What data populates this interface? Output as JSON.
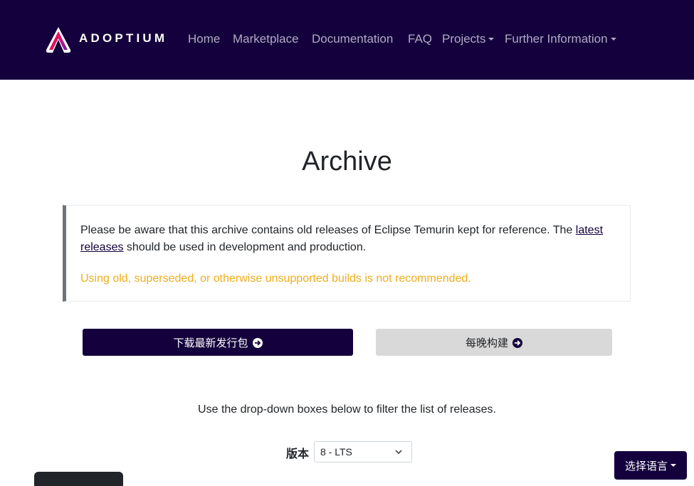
{
  "header": {
    "brand": "ADOPTIUM",
    "nav": [
      {
        "label": "Home"
      },
      {
        "label": "Marketplace"
      },
      {
        "label": "Documentation"
      },
      {
        "label": "FAQ"
      },
      {
        "label": "Projects",
        "dropdown": true
      },
      {
        "label": "Further Information",
        "dropdown": true
      }
    ],
    "colors": {
      "bg": "#14003c",
      "nav_text": "#b0abc6"
    }
  },
  "main": {
    "title": "Archive",
    "notice": {
      "before_link": "Please be aware that this archive contains old releases of Eclipse Temurin kept for reference. The ",
      "link": "latest releases",
      "after_link": " should be used in development and production.",
      "warning": "Using old, superseded, or otherwise unsupported builds is not recommended.",
      "warning_color": "#f0ad1b"
    },
    "buttons": {
      "latest": "下载最新发行包",
      "nightly": "每晚构建"
    },
    "filter_help": "Use the drop-down boxes below to filter the list of releases.",
    "version": {
      "label": "版本",
      "selected": "8 - LTS"
    }
  },
  "language_button": "选择语言",
  "icons": [
    "adoptium-logo",
    "arrow-circle-right-icon",
    "chevron-down-icon",
    "caret-down-icon"
  ]
}
